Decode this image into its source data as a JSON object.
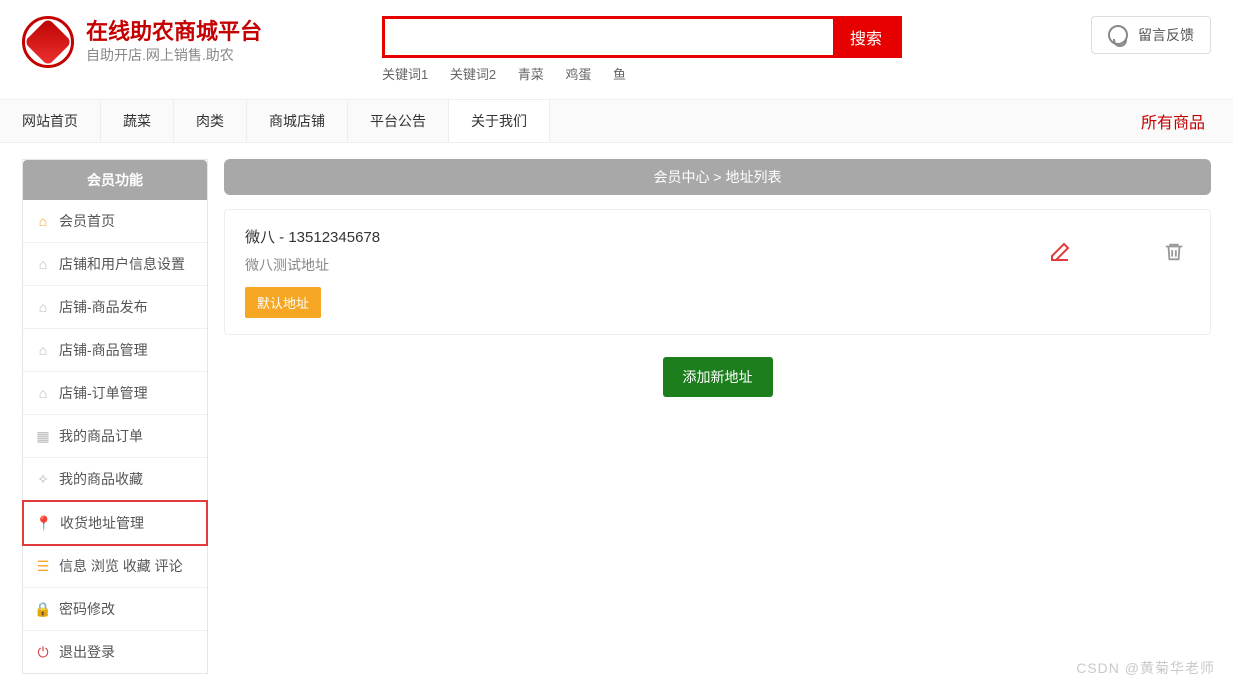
{
  "brand": {
    "title": "在线助农商城平台",
    "subtitle": "自助开店.网上销售.助农"
  },
  "search": {
    "placeholder": "",
    "button": "搜索",
    "keywords": [
      "关键词1",
      "关键词2",
      "青菜",
      "鸡蛋",
      "鱼"
    ]
  },
  "feedback": {
    "label": "留言反馈"
  },
  "nav": {
    "items": [
      "网站首页",
      "蔬菜",
      "肉类",
      "商城店铺",
      "平台公告",
      "关于我们"
    ],
    "right": "所有商品"
  },
  "sidebar": {
    "title": "会员功能",
    "items": [
      {
        "label": "会员首页",
        "icon": "home",
        "color": "orange"
      },
      {
        "label": "店铺和用户信息设置",
        "icon": "house"
      },
      {
        "label": "店铺-商品发布",
        "icon": "house"
      },
      {
        "label": "店铺-商品管理",
        "icon": "house"
      },
      {
        "label": "店铺-订单管理",
        "icon": "house"
      },
      {
        "label": "我的商品订单",
        "icon": "grid"
      },
      {
        "label": "我的商品收藏",
        "icon": "star"
      },
      {
        "label": "收货地址管理",
        "icon": "pin",
        "color": "green",
        "highlight": true
      },
      {
        "label": "信息 浏览 收藏 评论",
        "icon": "list",
        "color": "orange"
      },
      {
        "label": "密码修改",
        "icon": "lock",
        "color": "orange"
      },
      {
        "label": "退出登录",
        "icon": "power",
        "color": "red"
      }
    ]
  },
  "breadcrumb": {
    "text": "会员中心 > 地址列表"
  },
  "address": {
    "title": "微八 - 13512345678",
    "detail": "微八测试地址",
    "default_tag": "默认地址"
  },
  "add_button": "添加新地址",
  "watermark": "CSDN @黄菊华老师"
}
